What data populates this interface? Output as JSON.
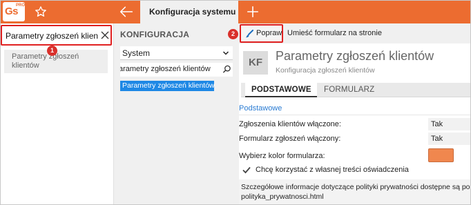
{
  "app": {
    "logo": {
      "text": "Gs",
      "pro": "PRO"
    },
    "active_tab": "Konfiguracja systemu",
    "accent_color": "#ec6c30"
  },
  "search": {
    "value": "Parametry zgłoszeń klien",
    "badge": "1",
    "results": [
      "Parametry zgłoszeń klientów"
    ]
  },
  "config": {
    "title": "KONFIGURACJA",
    "select_value": "System",
    "filter_value": "arametry zgłoszeń klientów",
    "items": [
      "Parametry zgłoszeń klientów"
    ]
  },
  "toolbar": {
    "badge": "2",
    "fix_label": "Popraw",
    "embed_label": "Umieść formularz na stronie"
  },
  "page": {
    "initials": "KF",
    "title": "Parametry zgłoszeń klientów",
    "subtitle": "Konfiguracja zgłoszeń klientów",
    "tabs": [
      "PODSTAWOWE",
      "FORMULARZ"
    ],
    "section": "Podstawowe",
    "fields": [
      {
        "label": "Zgłoszenia klientów włączone:",
        "value": "Tak"
      },
      {
        "label": "Formularz zgłoszeń włączony:",
        "value": "Tak"
      }
    ],
    "color_label": "Wybierz kolor formularza:",
    "form_color": "#f0874e",
    "checkbox_label": "Chcę korzystać z własnej treści oświadczenia",
    "info_text": "Szczegółowe informacje dotyczące polityki prywatności dostępne są pod polityka_prywatnosci.html"
  }
}
